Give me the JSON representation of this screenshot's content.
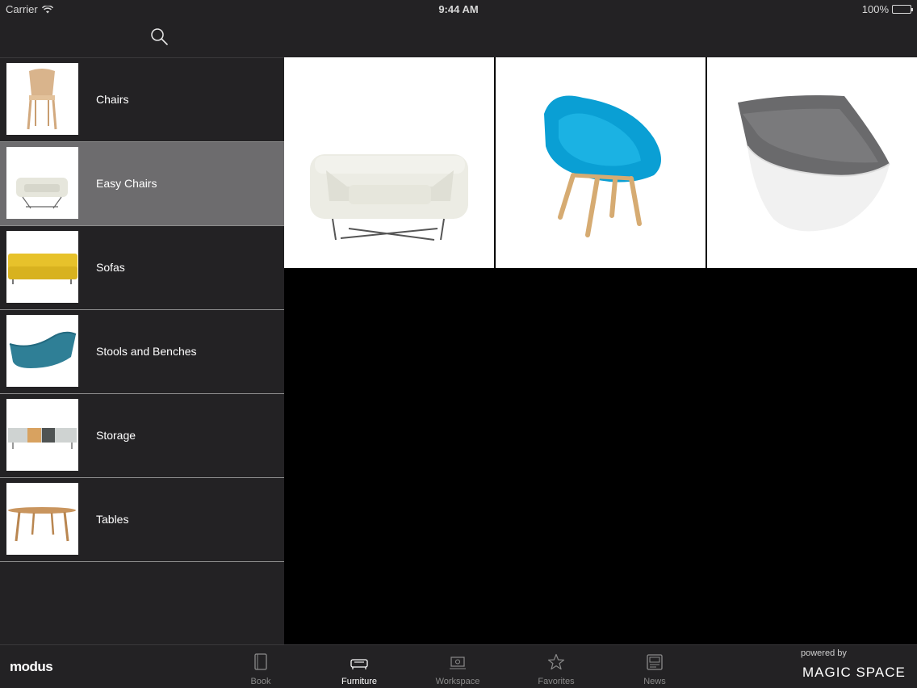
{
  "status_bar": {
    "carrier": "Carrier",
    "time": "9:44 AM",
    "battery": "100%"
  },
  "nav": {
    "search_icon": "search-icon"
  },
  "categories": [
    {
      "label": "Chairs",
      "icon": "chair-thumbnail"
    },
    {
      "label": "Easy Chairs",
      "icon": "easy-chair-thumbnail",
      "selected": true
    },
    {
      "label": "Sofas",
      "icon": "sofa-thumbnail"
    },
    {
      "label": "Stools and Benches",
      "icon": "stool-thumbnail"
    },
    {
      "label": "Storage",
      "icon": "storage-thumbnail"
    },
    {
      "label": "Tables",
      "icon": "table-thumbnail"
    }
  ],
  "products": [
    {
      "name": "white-easy-chair-image"
    },
    {
      "name": "blue-easy-chair-image"
    },
    {
      "name": "grey-shell-chair-image"
    }
  ],
  "tab_bar": {
    "brand": "modus",
    "tabs": [
      {
        "label": "Book",
        "icon": "book-icon",
        "active": false
      },
      {
        "label": "Furniture",
        "icon": "sofa-icon",
        "active": true
      },
      {
        "label": "Workspace",
        "icon": "workspace-icon",
        "active": false
      },
      {
        "label": "Favorites",
        "icon": "star-icon",
        "active": false
      },
      {
        "label": "News",
        "icon": "news-icon",
        "active": false
      }
    ],
    "powered_by": "powered by",
    "powered_name": "MAGIC SPACE"
  },
  "colors": {
    "bar_bg": "#232224",
    "selected_row": "#6d6c6e",
    "inactive_tab": "#8a8a8a",
    "content_bg": "#000000"
  }
}
